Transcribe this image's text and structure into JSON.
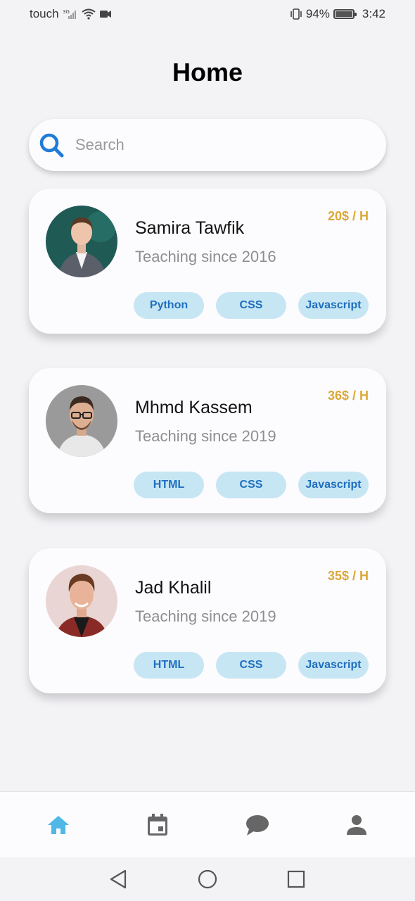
{
  "status_bar": {
    "carrier": "touch",
    "network": "3G",
    "battery": "94%",
    "time": "3:42"
  },
  "page": {
    "title": "Home"
  },
  "search": {
    "placeholder": "Search",
    "value": ""
  },
  "teachers": [
    {
      "name": "Samira Tawfik",
      "since": "Teaching since 2016",
      "price": "20$ / H",
      "tags": [
        "Python",
        "CSS",
        "Javascript"
      ]
    },
    {
      "name": "Mhmd Kassem",
      "since": "Teaching since 2019",
      "price": "36$ / H",
      "tags": [
        "HTML",
        "CSS",
        "Javascript"
      ]
    },
    {
      "name": "Jad Khalil",
      "since": "Teaching since 2019",
      "price": "35$ / H",
      "tags": [
        "HTML",
        "CSS",
        "Javascript"
      ]
    }
  ],
  "bottom_nav": {
    "items": [
      {
        "icon": "home-icon",
        "active": true
      },
      {
        "icon": "calendar-icon",
        "active": false
      },
      {
        "icon": "chat-icon",
        "active": false
      },
      {
        "icon": "profile-icon",
        "active": false
      }
    ]
  },
  "colors": {
    "accent": "#4fb8e6",
    "tag_bg": "#c7e6f4",
    "tag_text": "#1f6fbf",
    "price": "#dba838",
    "search_icon": "#1f7bd6"
  }
}
